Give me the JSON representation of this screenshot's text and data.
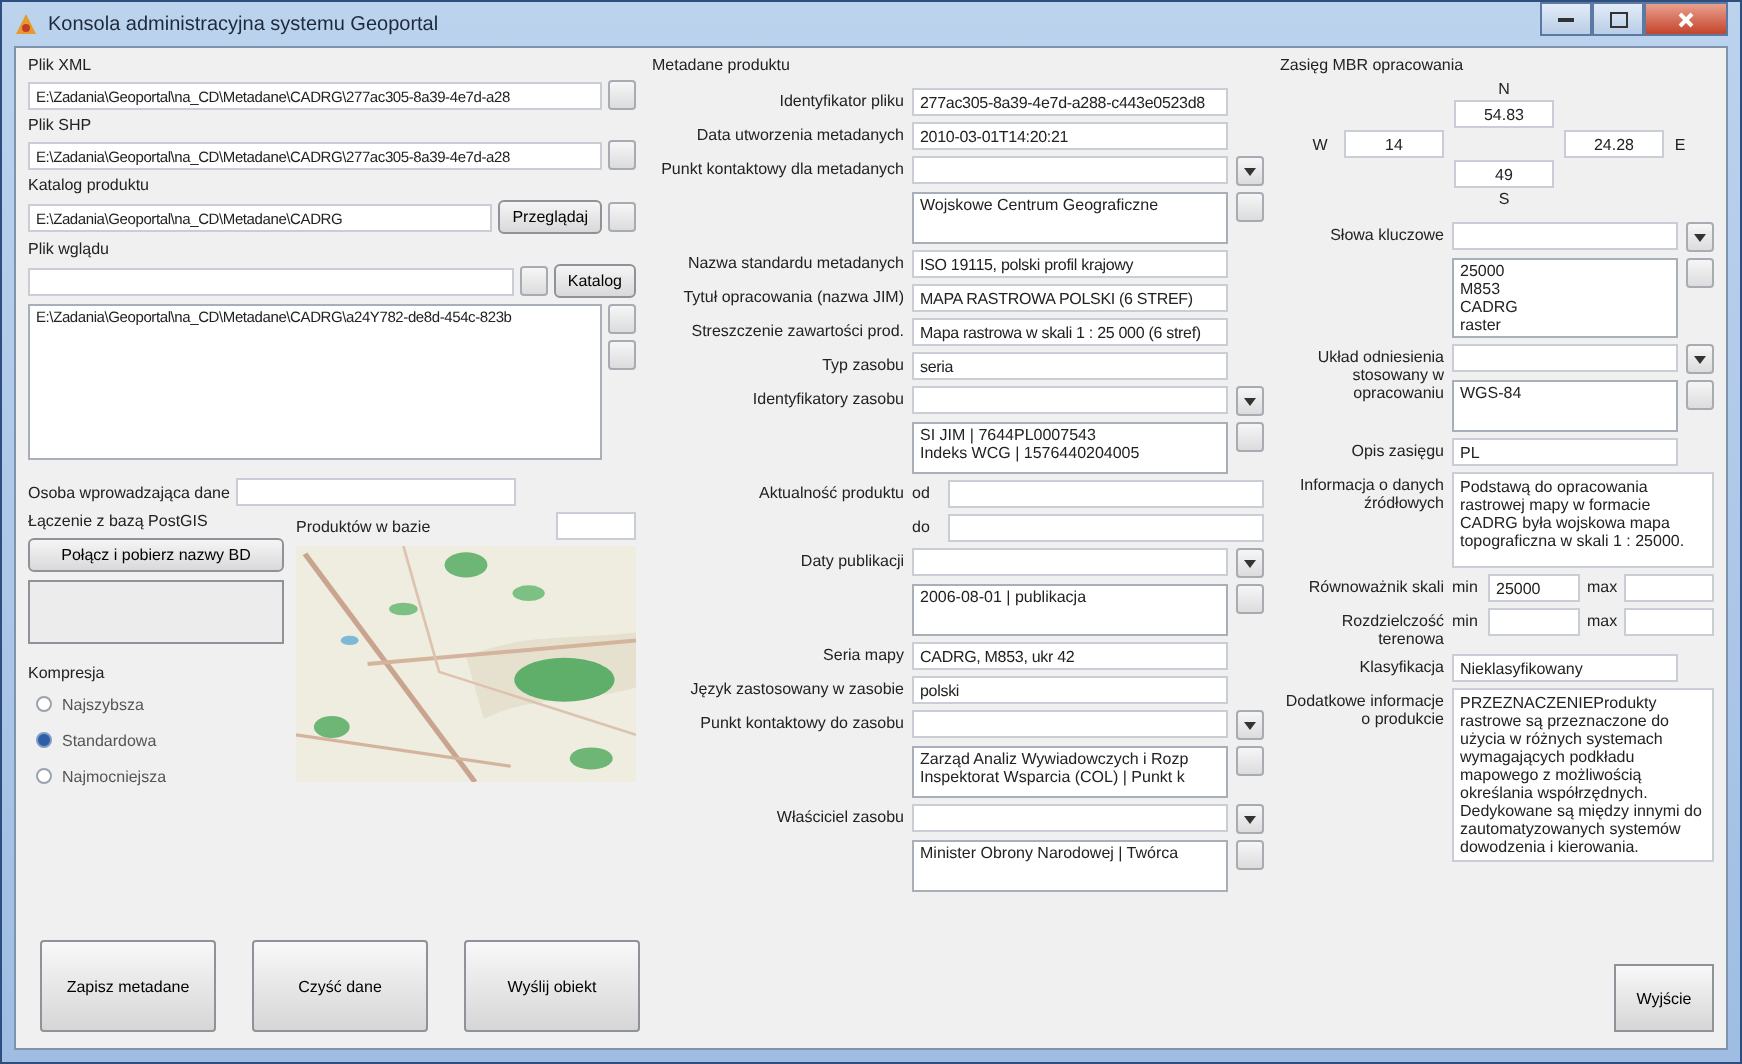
{
  "window": {
    "title": "Konsola administracyjna systemu Geoportal"
  },
  "files": [
    {
      "label": "Plik XML",
      "value": "E:\\Zadania\\Geoportal\\na_CD\\Metadane\\CADRG\\277ac305-8a39-4e7d-a28"
    },
    {
      "label": "Plik SHP",
      "value": "E:\\Zadania\\Geoportal\\na_CD\\Metadane\\CADRG\\277ac305-8a39-4e7d-a28"
    }
  ],
  "catalog": {
    "label": "Katalog produktu",
    "value": "E:\\Zadania\\Geoportal\\na_CD\\Metadane\\CADRG",
    "button": "Przeglądaj"
  },
  "view_file": {
    "label": "Plik wglądu",
    "button": "Katalog",
    "items": [
      "E:\\Zadania\\Geoportal\\na_CD\\Metadane\\CADRG\\a24Y782-de8d-454c-823b"
    ]
  },
  "operator": {
    "label": "Osoba wprowadzająca dane"
  },
  "database": {
    "label": "Łączenie z bazą PostGIS",
    "button": "Połącz i pobierz nazwy BD"
  },
  "products_count": {
    "label": "Produktów w bazie"
  },
  "compression": {
    "label": "Kompresja",
    "options": [
      {
        "label": "Najszybsza",
        "selected": false
      },
      {
        "label": "Standardowa",
        "selected": true
      },
      {
        "label": "Najmocniejsza",
        "selected": false
      }
    ]
  },
  "actions": [
    "Zapisz metadane",
    "Czyść dane",
    "Wyślij obiekt"
  ],
  "metadata": {
    "title": "Metadane produktu",
    "rows": [
      {
        "kind": "text",
        "label": "Identyfikator pliku",
        "value": "277ac305-8a39-4e7d-a288-c443e0523d8"
      },
      {
        "kind": "text",
        "label": "Data utworzenia metadanych",
        "value": "2010-03-01T14:20:21"
      },
      {
        "kind": "combo_list",
        "label": "Punkt kontaktowy dla metadanych",
        "items": [
          "Wojskowe Centrum Geograficzne"
        ]
      },
      {
        "kind": "text",
        "label": "Nazwa standardu metadanych",
        "value": "ISO 19115, polski profil krajowy"
      },
      {
        "kind": "text",
        "label": "Tytuł opracowania (nazwa JIM)",
        "value": "MAPA RASTROWA POLSKI (6 STREF)"
      },
      {
        "kind": "text",
        "label": "Streszczenie zawartości prod.",
        "value": "Mapa rastrowa w skali 1 : 25 000 (6 stref)"
      },
      {
        "kind": "text",
        "label": "Typ zasobu",
        "value": "seria"
      },
      {
        "kind": "combo_list",
        "label": "Identyfikatory zasobu",
        "items": [
          "SI JIM | 7644PL0007543",
          "Indeks WCG | 1576440204005"
        ]
      },
      {
        "kind": "range",
        "label": "Aktualność produktu",
        "parts": [
          {
            "prefix": "od"
          },
          {
            "prefix": "do"
          }
        ]
      },
      {
        "kind": "combo_list",
        "label": "Daty publikacji",
        "items": [
          "2006-08-01 | publikacja"
        ]
      },
      {
        "kind": "text",
        "label": "Seria mapy",
        "value": "CADRG, M853, ukr 42"
      },
      {
        "kind": "text",
        "label": "Język zastosowany w zasobie",
        "value": "polski"
      },
      {
        "kind": "combo_list",
        "label": "Punkt kontaktowy do zasobu",
        "items": [
          "Zarząd Analiz Wywiadowczych i Rozp",
          "Inspektorat Wsparcia (COL) | Punkt k"
        ]
      },
      {
        "kind": "combo_list",
        "label": "Właściciel zasobu",
        "items": [
          "Minister Obrony Narodowej | Twórca"
        ]
      }
    ]
  },
  "extent": {
    "title": "Zasięg MBR opracowania",
    "north_label": "N",
    "north": "54.83",
    "west_label": "W",
    "west": "14",
    "east": "24.28",
    "east_label": "E",
    "south": "49",
    "south_label": "S"
  },
  "details": [
    {
      "kind": "combo_list",
      "label": "Słowa kluczowe",
      "items": [
        "25000",
        "M853",
        "CADRG",
        "raster"
      ]
    },
    {
      "kind": "combo_list",
      "label": "Układ odniesienia stosowany w opracowaniu",
      "items": [
        "WGS-84"
      ]
    },
    {
      "kind": "text",
      "label": "Opis zasięgu",
      "value": "PL"
    },
    {
      "kind": "textarea",
      "label": "Informacja o danych źródłowych",
      "value": "Podstawą do opracowania rastrowej mapy w formacie CADRG była wojskowa mapa topograficzna w skali 1 : 25000."
    },
    {
      "kind": "range",
      "label": "Równoważnik skali",
      "parts": [
        {
          "prefix": "min",
          "value": "25000"
        },
        {
          "prefix": "max"
        }
      ]
    },
    {
      "kind": "range",
      "label": "Rozdzielczość terenowa",
      "parts": [
        {
          "prefix": "min"
        },
        {
          "prefix": "max"
        }
      ]
    },
    {
      "kind": "text",
      "label": "Klasyfikacja",
      "value": "Nieklasyfikowany"
    },
    {
      "kind": "textarea",
      "label": "Dodatkowe informacje o produkcie",
      "value": "PRZEZNACZENIEProdukty rastrowe są przeznaczone do użycia w różnych systemach wymagających podkładu mapowego z możliwością określania współrzędnych. Dedykowane są między innymi do zautomatyzowanych systemów dowodzenia i kierowania."
    }
  ],
  "exit_button": "Wyjście"
}
